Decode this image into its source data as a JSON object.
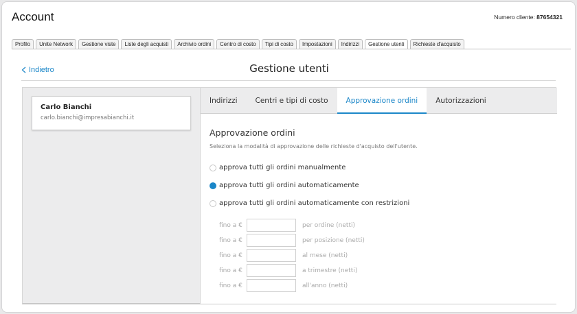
{
  "header": {
    "title": "Account",
    "customer_label": "Numero cliente:",
    "customer_number": "87654321"
  },
  "tabs": [
    {
      "label": "Profilo"
    },
    {
      "label": "Unite Network"
    },
    {
      "label": "Gestione viste"
    },
    {
      "label": "Liste degli acquisti"
    },
    {
      "label": "Archivio ordini"
    },
    {
      "label": "Centro di costo"
    },
    {
      "label": "Tipi di costo"
    },
    {
      "label": "Impostazioni"
    },
    {
      "label": "Indirizzi"
    },
    {
      "label": "Gestione utenti",
      "active": true
    },
    {
      "label": "Richieste d'acquisto"
    }
  ],
  "page": {
    "back_label": "Indietro",
    "title": "Gestione utenti"
  },
  "user": {
    "name": "Carlo Bianchi",
    "email": "carlo.bianchi@impresabianchi.it"
  },
  "subtabs": [
    {
      "label": "Indirizzi"
    },
    {
      "label": "Centri e tipi di costo"
    },
    {
      "label": "Approvazione ordini",
      "active": true
    },
    {
      "label": "Autorizzazioni"
    }
  ],
  "approval": {
    "title": "Approvazione ordini",
    "description": "Seleziona la modalità di approvazione delle richieste d'acquisto dell'utente.",
    "options": [
      {
        "label": "approva tutti gli ordini manualmente",
        "selected": false
      },
      {
        "label": "approva tutti gli ordini automaticamente",
        "selected": true
      },
      {
        "label": "approva tutti gli ordini automaticamente con restrizioni",
        "selected": false
      }
    ],
    "limits": [
      {
        "prefix": "fino a €",
        "value": "",
        "suffix": "per ordine (netti)"
      },
      {
        "prefix": "fino a €",
        "value": "",
        "suffix": "per posizione (netti)"
      },
      {
        "prefix": "fino a €",
        "value": "",
        "suffix": "al mese (netti)"
      },
      {
        "prefix": "fino a €",
        "value": "",
        "suffix": "a trimestre (netti)"
      },
      {
        "prefix": "fino a €",
        "value": "",
        "suffix": "all'anno (netti)"
      }
    ]
  },
  "colors": {
    "accent": "#1a86c8"
  }
}
